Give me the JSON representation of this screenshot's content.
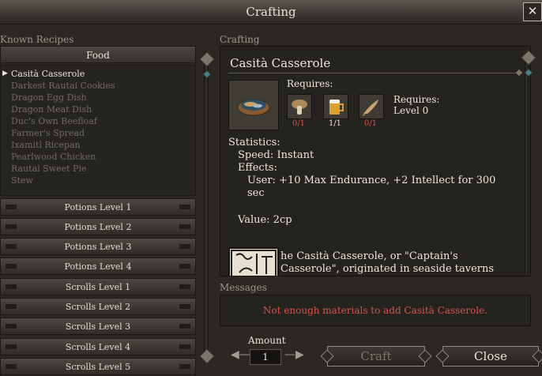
{
  "window": {
    "title": "Crafting",
    "close_glyph": "✕"
  },
  "known_recipes": {
    "label": "Known Recipes",
    "category_header": "Food",
    "items": [
      "Casità Casserole",
      "Darkest Rautai Cookies",
      "Dragon Egg Dish",
      "Dragon Meat Dish",
      "Duc's Own Beefloaf",
      "Farmer's Spread",
      "Ixamitl Ricepan",
      "Pearlwood Chicken",
      "Rautai Sweet Pie",
      "Stew"
    ],
    "selected_index": 0,
    "categories": [
      "Potions Level 1",
      "Potions Level 2",
      "Potions Level 3",
      "Potions Level 4",
      "Scrolls Level 1",
      "Scrolls Level 2",
      "Scrolls Level 3",
      "Scrolls Level 4",
      "Scrolls Level 5"
    ]
  },
  "crafting": {
    "label": "Crafting",
    "recipe_title": "Casità Casserole",
    "requires_label": "Requires:",
    "ingredients": [
      {
        "icon": "mushroom-icon",
        "count": "0/1",
        "status": "missing"
      },
      {
        "icon": "ale-mug-icon",
        "count": "1/1",
        "status": "ok"
      },
      {
        "icon": "fish-icon",
        "count": "0/1",
        "status": "missing"
      }
    ],
    "requires_side": {
      "label": "Requires:",
      "level": "Level 0"
    },
    "statistics": {
      "label": "Statistics:",
      "speed": "Speed: Instant",
      "effects_label": "Effects:",
      "effect_line1": "User: +10 Max Endurance, +2 Intellect for 300",
      "effect_line2": "sec",
      "value": "Value: 2cp"
    },
    "lore": "he Casità Casserole, or \"Captain's Casserole\", originated in seaside taverns"
  },
  "messages": {
    "label": "Messages",
    "text": "Not enough materials to add Casità Casserole."
  },
  "bottom": {
    "amount_label": "Amount",
    "amount_value": "1",
    "craft_label": "Craft",
    "close_label": "Close"
  },
  "colors": {
    "error": "#d6534a",
    "text": "#ece6d8",
    "dim": "#6f6a63"
  }
}
